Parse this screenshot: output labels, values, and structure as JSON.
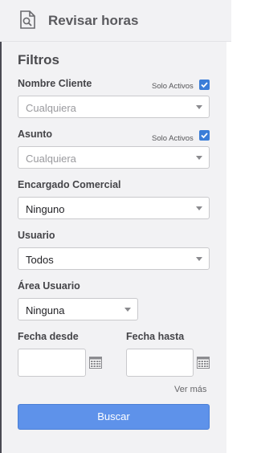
{
  "header": {
    "title": "Revisar horas",
    "icon": "search-document-icon"
  },
  "filters": {
    "title": "Filtros",
    "nombre_cliente": {
      "label": "Nombre Cliente",
      "solo_activos_label": "Solo Activos",
      "solo_activos_checked": true,
      "value": "Cualquiera"
    },
    "asunto": {
      "label": "Asunto",
      "solo_activos_label": "Solo Activos",
      "solo_activos_checked": true,
      "value": "Cualquiera"
    },
    "encargado_comercial": {
      "label": "Encargado Comercial",
      "value": "Ninguno"
    },
    "usuario": {
      "label": "Usuario",
      "value": "Todos"
    },
    "area_usuario": {
      "label": "Área Usuario",
      "value": "Ninguna"
    },
    "fecha_desde": {
      "label": "Fecha desde",
      "value": "",
      "icon": "calendar-icon"
    },
    "fecha_hasta": {
      "label": "Fecha hasta",
      "value": "",
      "icon": "calendar-icon"
    },
    "ver_mas": "Ver más",
    "buscar": "Buscar"
  },
  "colors": {
    "accent": "#5e92ea",
    "checkbox": "#3b7dd8",
    "panel": "#f2f2f4"
  }
}
